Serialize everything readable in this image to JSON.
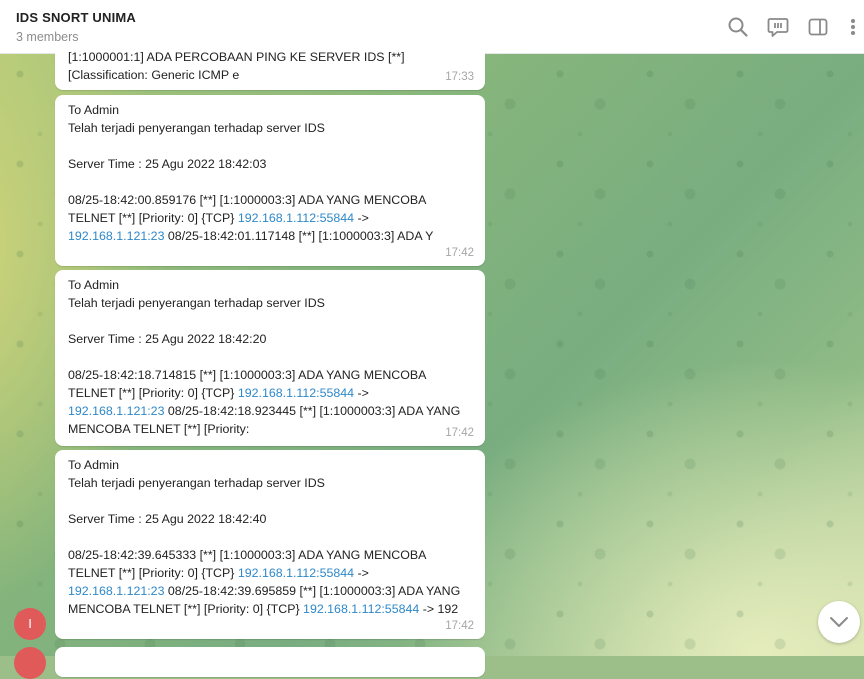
{
  "header": {
    "title": "IDS SNORT UNIMA",
    "subtitle": "3 members",
    "icons": [
      "search-icon",
      "topic-icon",
      "sidebar-icon",
      "more-icon"
    ]
  },
  "messages": [
    {
      "lines": [
        "[1:1000001:1] ADA PERCOBAAN PING KE SERVER IDS [**]",
        "[Classification: Generic ICMP e"
      ],
      "time": "17:33"
    },
    {
      "to": "To Admin",
      "headline": " Telah terjadi penyerangan terhadap server IDS",
      "server_time": "Server Time : 25 Agu 2022 18:42:03",
      "log1": "08/25-18:42:00.859176 [**] [1:1000003:3] ADA YANG MENCOBA",
      "log2_pre": "TELNET [**] [Priority: 0] {TCP} ",
      "log2_link": "192.168.1.112:55844",
      "log2_post": " ->",
      "log3_link": "192.168.1.121:23",
      "log3_post": " 08/25-18:42:01.117148 [**] [1:1000003:3] ADA Y",
      "time": "17:42"
    },
    {
      "to": "To Admin",
      "headline": " Telah terjadi penyerangan terhadap server IDS",
      "server_time": "Server Time : 25 Agu 2022 18:42:20",
      "log1": "08/25-18:42:18.714815 [**] [1:1000003:3] ADA YANG MENCOBA",
      "log2_pre": "TELNET [**] [Priority: 0] {TCP} ",
      "log2_link": "192.168.1.112:55844",
      "log2_post": " ->",
      "log3_link": "192.168.1.121:23",
      "log3_post": " 08/25-18:42:18.923445 [**] [1:1000003:3] ADA YANG",
      "log4": "MENCOBA TELNET [**] [Priority:",
      "time": "17:42"
    },
    {
      "to": "To Admin",
      "headline": " Telah terjadi penyerangan terhadap server IDS",
      "server_time": "Server Time : 25 Agu 2022 18:42:40",
      "log1": "08/25-18:42:39.645333 [**] [1:1000003:3] ADA YANG MENCOBA",
      "log2_pre": "TELNET [**] [Priority: 0] {TCP} ",
      "log2_link": "192.168.1.112:55844",
      "log2_post": " ->",
      "log3_link": "192.168.1.121:23",
      "log3_post": " 08/25-18:42:39.695859 [**] [1:1000003:3] ADA YANG",
      "log4_pre": "MENCOBA TELNET [**] [Priority: 0] {TCP} ",
      "log4_link": "192.168.1.112:55844",
      "log4_post": " -> 192",
      "time": "17:42"
    }
  ],
  "avatar_letter": "I",
  "colors": {
    "link": "#2e88c8",
    "avatar": "#e05a5a",
    "timestamp": "#a6a6a6"
  }
}
